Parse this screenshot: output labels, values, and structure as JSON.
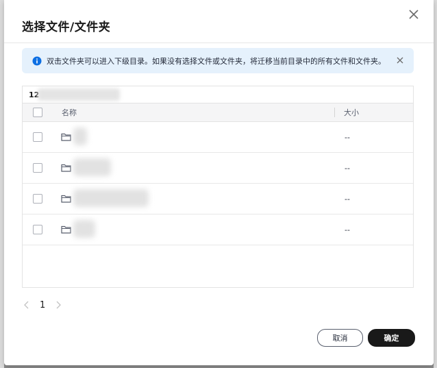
{
  "dialog": {
    "title": "选择文件/文件夹",
    "close_icon": "close-icon"
  },
  "notice": {
    "icon": "info-icon",
    "text": "双击文件夹可以进入下级目录。如果没有选择文件或文件夹，将迁移当前目录中的所有文件和文件夹。",
    "dismiss_icon": "close-icon"
  },
  "path": {
    "prefix": "12"
  },
  "table": {
    "columns": [
      "名称",
      "大小"
    ],
    "rows": [
      {
        "size": "--"
      },
      {
        "size": "--"
      },
      {
        "size": "--"
      },
      {
        "size": "--"
      }
    ]
  },
  "pagination": {
    "current_page": "1"
  },
  "buttons": {
    "cancel": "取消",
    "confirm": "确定"
  },
  "colors": {
    "notice_bg": "#e5f1fc",
    "info_blue": "#0d6fe3",
    "primary_button": "#191919"
  }
}
